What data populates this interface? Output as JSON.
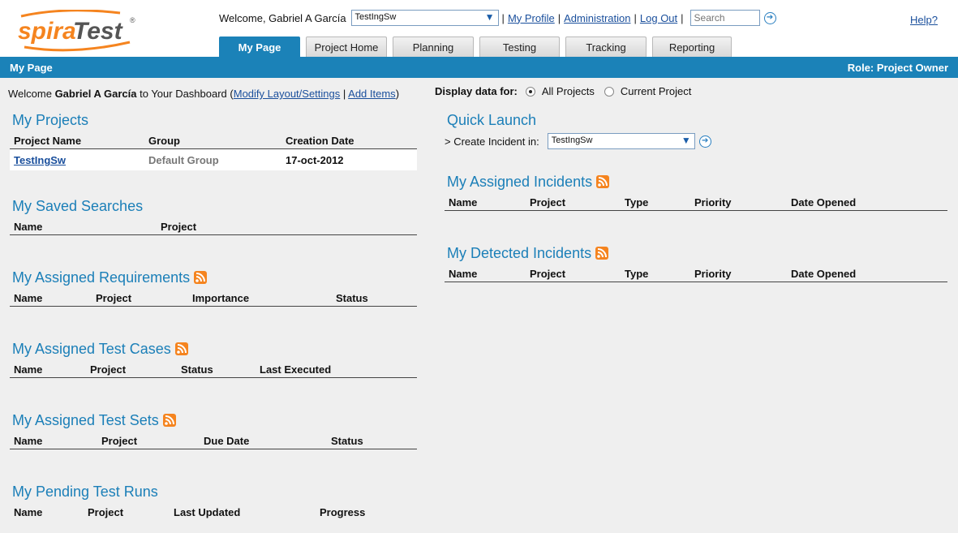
{
  "header": {
    "logo_text": "spiraTest",
    "welcome_text": "Welcome, Gabriel A García",
    "project_select_value": "TestIngSw",
    "links": {
      "my_profile": "My Profile",
      "administration": "Administration",
      "log_out": "Log Out",
      "help": "Help?"
    },
    "separator": "|",
    "search_placeholder": "Search"
  },
  "tabs": [
    {
      "label": "My Page",
      "active": true
    },
    {
      "label": "Project Home",
      "active": false
    },
    {
      "label": "Planning",
      "active": false
    },
    {
      "label": "Testing",
      "active": false
    },
    {
      "label": "Tracking",
      "active": false
    },
    {
      "label": "Reporting",
      "active": false
    }
  ],
  "titlebar": {
    "page_title": "My Page",
    "role": "Role: Project Owner"
  },
  "intro": {
    "prefix": "Welcome ",
    "user": "Gabriel A García",
    "suffix": " to Your Dashboard (",
    "modify_link": "Modify Layout/Settings",
    "sep": " | ",
    "add_link": "Add Items",
    "close": ")"
  },
  "display_for": {
    "label": "Display data for:",
    "options": [
      "All Projects",
      "Current Project"
    ],
    "selected": "All Projects"
  },
  "my_projects": {
    "title": "My Projects",
    "columns": [
      "Project Name",
      "Group",
      "Creation Date"
    ],
    "rows": [
      {
        "name": "TestIngSw",
        "group": "Default Group",
        "date": "17-oct-2012"
      }
    ]
  },
  "my_saved_searches": {
    "title": "My Saved Searches",
    "columns": [
      "Name",
      "Project"
    ]
  },
  "my_assigned_requirements": {
    "title": "My Assigned Requirements",
    "columns": [
      "Name",
      "Project",
      "Importance",
      "Status"
    ]
  },
  "my_assigned_test_cases": {
    "title": "My Assigned Test Cases",
    "columns": [
      "Name",
      "Project",
      "Status",
      "Last Executed"
    ]
  },
  "my_assigned_test_sets": {
    "title": "My Assigned Test Sets",
    "columns": [
      "Name",
      "Project",
      "Due Date",
      "Status"
    ]
  },
  "my_pending_test_runs": {
    "title": "My Pending Test Runs",
    "columns": [
      "Name",
      "Project",
      "Last Updated",
      "Progress"
    ]
  },
  "quick_launch": {
    "title": "Quick Launch",
    "create_label": "> Create Incident in:",
    "project_value": "TestIngSw"
  },
  "my_assigned_incidents": {
    "title": "My Assigned Incidents",
    "columns": [
      "Name",
      "Project",
      "Type",
      "Priority",
      "Date Opened"
    ]
  },
  "my_detected_incidents": {
    "title": "My Detected Incidents",
    "columns": [
      "Name",
      "Project",
      "Type",
      "Priority",
      "Date Opened"
    ]
  },
  "colors": {
    "brand_blue": "#1b82b8",
    "logo_orange": "#f5841f",
    "section_title": "#1b7fb8"
  }
}
